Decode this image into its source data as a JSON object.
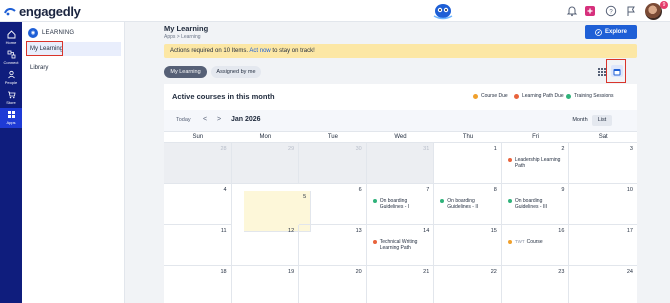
{
  "brand": {
    "name": "engagedly"
  },
  "header": {
    "icons": [
      "bell-icon",
      "add-icon",
      "help-icon",
      "flag-icon"
    ],
    "notification_badge": "9"
  },
  "rail": {
    "items": [
      {
        "label": "Home",
        "icon": "home-icon"
      },
      {
        "label": "Connect",
        "icon": "connect-icon"
      },
      {
        "label": "People",
        "icon": "people-icon"
      },
      {
        "label": "Store",
        "icon": "store-icon"
      },
      {
        "label": "Apps",
        "icon": "apps-icon",
        "active": true
      }
    ]
  },
  "subnav": {
    "heading": "LEARNING",
    "items": [
      {
        "label": "My Learning",
        "active": true
      },
      {
        "label": "Library"
      }
    ]
  },
  "page": {
    "title": "My Learning",
    "breadcrumb": "Apps  >  Learning",
    "explore_label": "Explore"
  },
  "banner": {
    "before": "Actions required on 10 Items.",
    "action": "Act now",
    "after": "to stay on track!"
  },
  "tabs": [
    {
      "label": "My Learning",
      "active": true
    },
    {
      "label": "Assigned by me"
    }
  ],
  "panel": {
    "title": "Active courses in this month",
    "legend": [
      {
        "label": "Course Due",
        "color": "#f0a02c"
      },
      {
        "label": "Learning Path Due",
        "color": "#e8633c"
      },
      {
        "label": "Training Sessions",
        "color": "#2fb27a"
      }
    ]
  },
  "calendar": {
    "today_label": "Today",
    "prev": "<",
    "next": ">",
    "month_label": "Jan 2026",
    "view_month": "Month",
    "view_list": "List",
    "days": [
      "Sun",
      "Mon",
      "Tue",
      "Wed",
      "Thu",
      "Fri",
      "Sat"
    ],
    "cells": [
      {
        "n": "28",
        "out": true
      },
      {
        "n": "29",
        "out": true
      },
      {
        "n": "30",
        "out": true
      },
      {
        "n": "31",
        "out": true
      },
      {
        "n": "1"
      },
      {
        "n": "2",
        "event": {
          "text": "Leadership Learning Path",
          "color": "#e8633c"
        }
      },
      {
        "n": "3"
      },
      {
        "n": "4"
      },
      {
        "n": "5",
        "today": true
      },
      {
        "n": "6"
      },
      {
        "n": "7",
        "event": {
          "text": "On boarding Guidelines - I",
          "color": "#2fb27a"
        }
      },
      {
        "n": "8",
        "event": {
          "text": "On boarding Guidelines - II",
          "color": "#2fb27a"
        }
      },
      {
        "n": "9",
        "event": {
          "text": "On boarding Guidelines - III",
          "color": "#2fb27a"
        }
      },
      {
        "n": "10"
      },
      {
        "n": "11"
      },
      {
        "n": "12"
      },
      {
        "n": "13"
      },
      {
        "n": "14",
        "event": {
          "text": "Technical Writing Learning Path",
          "color": "#e8633c"
        }
      },
      {
        "n": "15"
      },
      {
        "n": "16",
        "event": {
          "tag": "TWT",
          "text": "Course",
          "color": "#f0a02c"
        }
      },
      {
        "n": "17"
      },
      {
        "n": "18"
      },
      {
        "n": "19"
      },
      {
        "n": "20"
      },
      {
        "n": "21"
      },
      {
        "n": "22"
      },
      {
        "n": "23"
      },
      {
        "n": "24"
      }
    ]
  }
}
